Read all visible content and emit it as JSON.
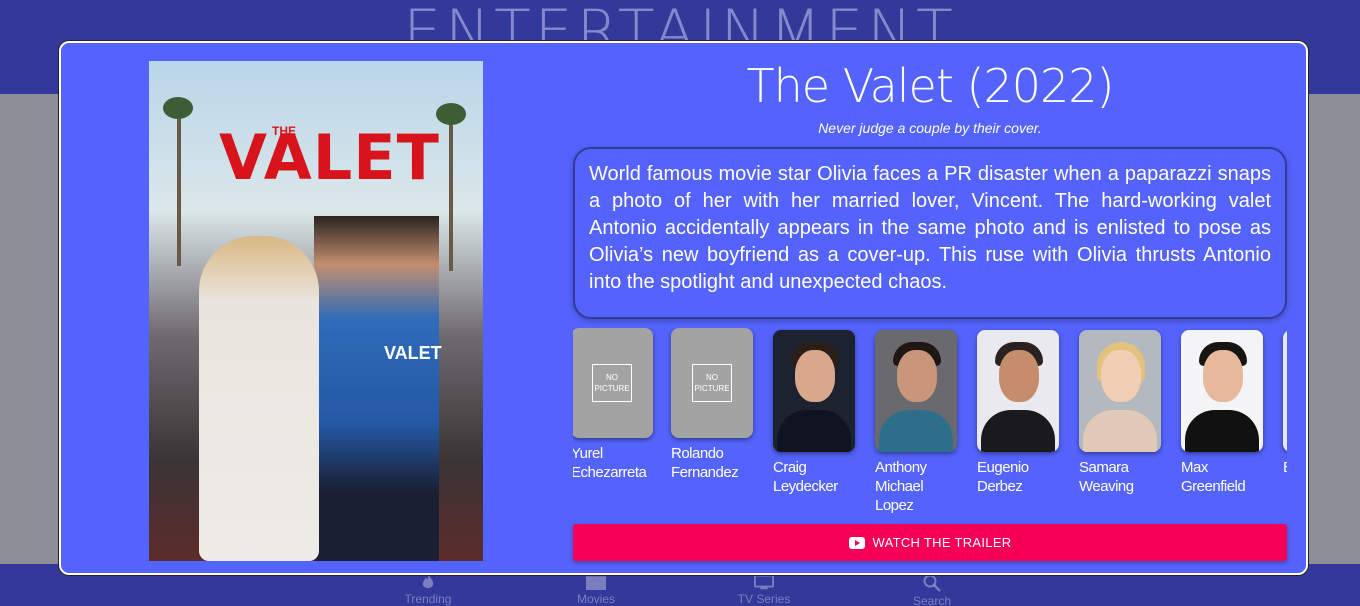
{
  "app": {
    "title": "ENTERTAINMENT"
  },
  "nav": [
    {
      "label": "Trending",
      "icon": "flame-icon"
    },
    {
      "label": "Movies",
      "icon": "movie-icon"
    },
    {
      "label": "TV Series",
      "icon": "tv-icon"
    },
    {
      "label": "Search",
      "icon": "search-icon"
    }
  ],
  "modal": {
    "poster": {
      "title": "VALET",
      "the": "THE",
      "vest": "VALET"
    },
    "title": "The Valet (2022)",
    "tagline": "Never judge a couple by their cover.",
    "overview": "World famous movie star Olivia faces a PR disaster when a paparazzi snaps a photo of her with her married lover, Vincent. The hard-working valet Antonio accidentally appears in the same photo and is enlisted to pose as Olivia’s new boyfriend as a cover-up. This ruse with Olivia thrusts Antonio into the spotlight and unexpected chaos.",
    "no_picture": "NO PICTURE",
    "cast": [
      {
        "name": "Yurel Echezarreta",
        "has_photo": false
      },
      {
        "name": "Rolando Fernandez",
        "has_photo": false
      },
      {
        "name": "Craig Leydecker",
        "has_photo": true
      },
      {
        "name": "Anthony Michael Lopez",
        "has_photo": true
      },
      {
        "name": "Eugenio Derbez",
        "has_photo": true
      },
      {
        "name": "Samara Weaving",
        "has_photo": true
      },
      {
        "name": "Max Greenfield",
        "has_photo": true
      },
      {
        "name": "B B",
        "has_photo": true
      }
    ],
    "trailer_label": "WATCH THE TRAILER",
    "colors": {
      "accent": "#f50057",
      "modal_bg": "#5463fb",
      "header_bg": "#33389b"
    }
  }
}
